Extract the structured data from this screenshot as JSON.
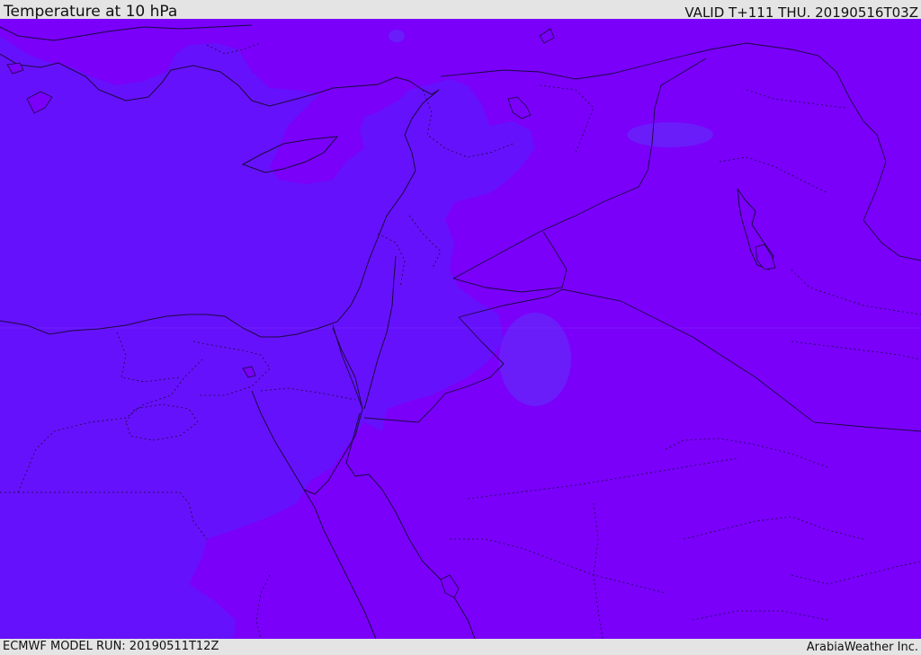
{
  "header": {
    "title": "Temperature at 10 hPa",
    "valid": "VALID T+111 THU. 20190516T03Z"
  },
  "footer": {
    "model_run": "ECMWF MODEL RUN: 20190511T12Z",
    "credit": "ArabiaWeather Inc."
  },
  "map": {
    "region": "Eastern Mediterranean and Middle East",
    "colors": {
      "warmer_field": "#7a00fa",
      "cooler_field": "#6611fb",
      "cool_patch": "#6a1cf9",
      "boundary_line": "#1a0a40"
    }
  }
}
